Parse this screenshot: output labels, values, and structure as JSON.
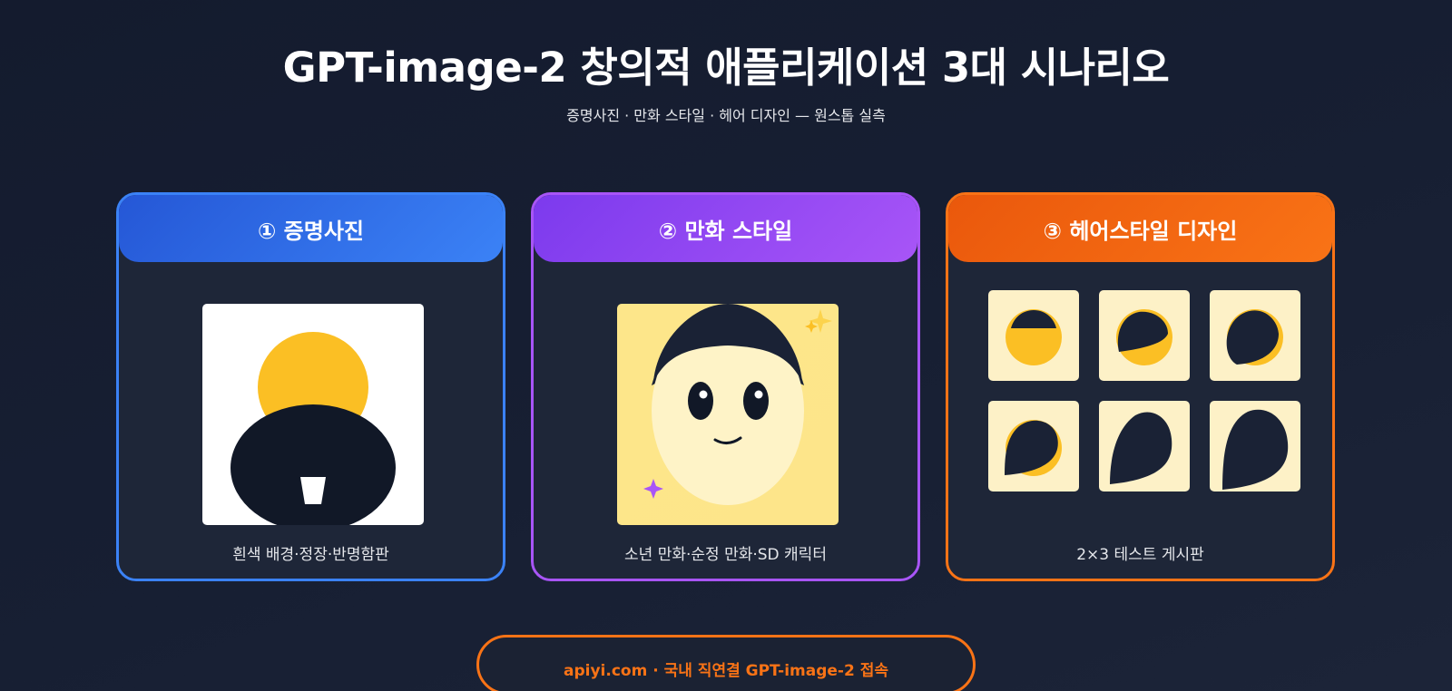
{
  "header": {
    "title": "GPT-image-2 창의적 애플리케이션 3대 시나리오",
    "subtitle": "증명사진 · 만화 스타일 · 헤어 디자인 — 원스톱 실측"
  },
  "cards": [
    {
      "title": "① 증명사진",
      "caption": "흰색 배경·정장·반명함판",
      "accent": "#3b82f6",
      "icon": "id-photo-illustration"
    },
    {
      "title": "② 만화 스타일",
      "caption": "소년 만화·순정 만화·SD 캐릭터",
      "accent": "#a855f7",
      "icon": "cartoon-face-illustration"
    },
    {
      "title": "③ 헤어스타일 디자인",
      "caption": "2×3 테스트 게시판",
      "accent": "#f97316",
      "icon": "hairstyle-grid-illustration"
    }
  ],
  "footer": {
    "cta_label": "apiyi.com · 국내 직연결 GPT-image-2 접속",
    "accent": "#f97316"
  },
  "colors": {
    "background": "#161d30",
    "card_background": "#1e2638",
    "face_yellow": "#fbbf24",
    "dark": "#111827",
    "cream": "#fdf1c7"
  }
}
